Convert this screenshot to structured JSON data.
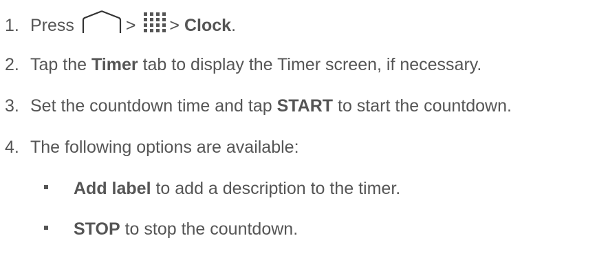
{
  "steps": [
    {
      "num": "1.",
      "press": "Press",
      "sep1": ">",
      "sep2": ">",
      "target": "Clock",
      "end": ".",
      "icons": [
        "home-icon",
        "apps-icon"
      ]
    },
    {
      "num": "2.",
      "pre": "Tap the",
      "bold": "Timer",
      "post": "tab to display the Timer screen, if necessary."
    },
    {
      "num": "3.",
      "pre": "Set the countdown time and tap",
      "bold": "START",
      "post": "to start the countdown."
    },
    {
      "num": "4.",
      "text": "The following options are available:"
    }
  ],
  "options": [
    {
      "bold": "Add label",
      "text": "to add a description to the timer."
    },
    {
      "bold": "STOP",
      "text": "to stop the countdown."
    }
  ]
}
